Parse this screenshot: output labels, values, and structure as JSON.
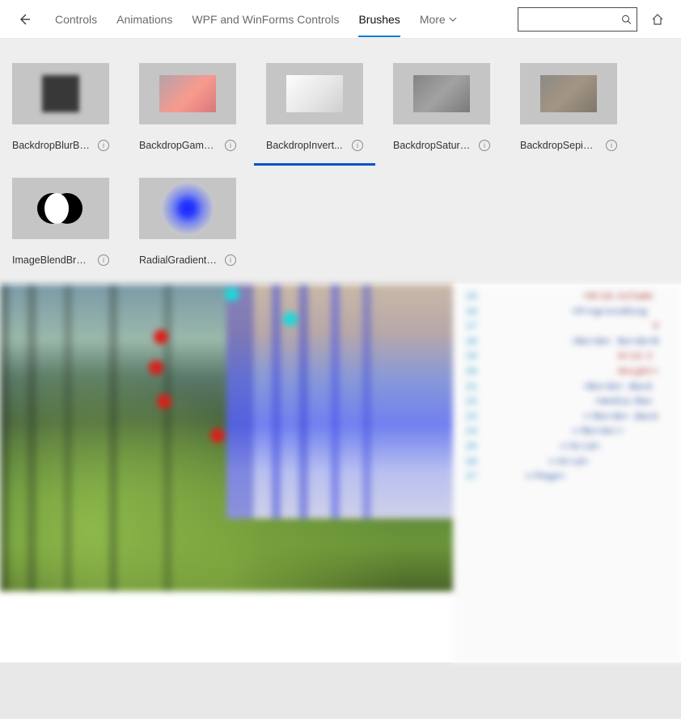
{
  "nav": {
    "items": [
      {
        "label": "Controls"
      },
      {
        "label": "Animations"
      },
      {
        "label": "WPF and WinForms Controls"
      },
      {
        "label": "Brushes",
        "active": true
      },
      {
        "label": "More",
        "dropdown": true
      }
    ],
    "search": {
      "placeholder": ""
    }
  },
  "gallery": {
    "items": [
      {
        "label": "BackdropBlurBr...",
        "full": "BackdropBlurBrush",
        "thumb": "blur"
      },
      {
        "label": "BackdropGamm...",
        "full": "BackdropGammaTransferBrush",
        "thumb": "gamma"
      },
      {
        "label": "BackdropInvert...",
        "full": "BackdropInvertBrush",
        "thumb": "invert",
        "selected": true
      },
      {
        "label": "BackdropSatura...",
        "full": "BackdropSaturationBrush",
        "thumb": "satur"
      },
      {
        "label": "BackdropSepiaB...",
        "full": "BackdropSepiaBrush",
        "thumb": "sepia"
      },
      {
        "label": "ImageBlendBrush",
        "full": "ImageBlendBrush",
        "thumb": "blend"
      },
      {
        "label": "RadialGradientB...",
        "full": "RadialGradientBrush",
        "thumb": "radial"
      }
    ]
  },
  "code": {
    "lines": [
      {
        "n": "15",
        "indent": 7,
        "cls": "tag",
        "t": "<Grid.Column"
      },
      {
        "n": "16",
        "indent": 6,
        "cls": "bluetext",
        "t": "<ProgressRing "
      },
      {
        "n": "17",
        "indent": 13,
        "cls": "tag",
        "t": "V"
      },
      {
        "n": "18",
        "indent": 6,
        "cls": "bluetext",
        "t": "<Border BorderB"
      },
      {
        "n": "19",
        "indent": 10,
        "cls": "attr",
        "t": "Grid.C"
      },
      {
        "n": "20",
        "indent": 10,
        "cls": "attr",
        "t": "Height="
      },
      {
        "n": "21",
        "indent": 7,
        "cls": "bluetext",
        "t": "<Border.Back"
      },
      {
        "n": "22",
        "indent": 8,
        "cls": "bluetext",
        "t": "<media:Bac"
      },
      {
        "n": "23",
        "indent": 7,
        "cls": "bluetext",
        "t": "</Border.Back"
      },
      {
        "n": "24",
        "indent": 6,
        "cls": "bluetext",
        "t": "</Border>"
      },
      {
        "n": "25",
        "indent": 5,
        "cls": "bluetext",
        "t": "</Grid>"
      },
      {
        "n": "26",
        "indent": 4,
        "cls": "bluetext",
        "t": "</Grid>"
      },
      {
        "n": "27",
        "indent": 2,
        "cls": "bluetext",
        "t": "</Page>"
      }
    ]
  }
}
